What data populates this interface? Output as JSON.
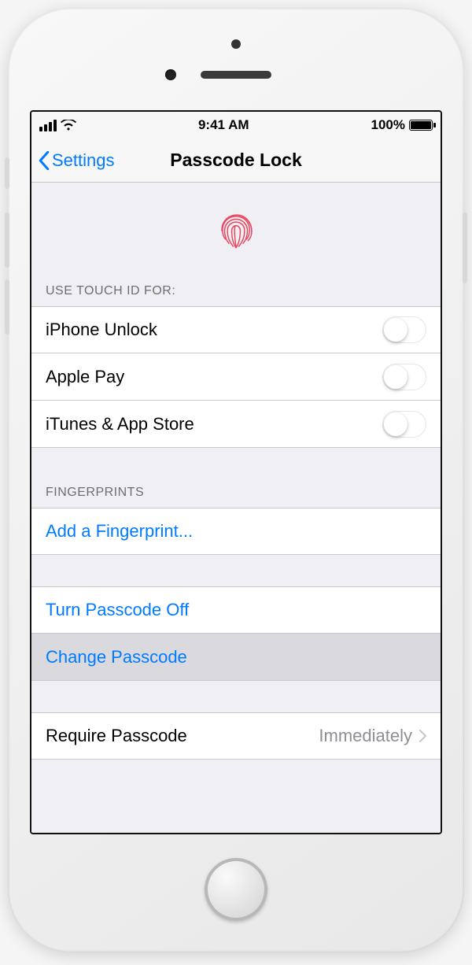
{
  "statusbar": {
    "time": "9:41 AM",
    "battery_pct": "100%"
  },
  "nav": {
    "back_label": "Settings",
    "title": "Passcode Lock"
  },
  "section_touchid": {
    "header": "USE TOUCH ID FOR:",
    "items": [
      {
        "label": "iPhone Unlock",
        "on": false
      },
      {
        "label": "Apple Pay",
        "on": false
      },
      {
        "label": "iTunes & App Store",
        "on": false
      }
    ]
  },
  "section_fingerprints": {
    "header": "FINGERPRINTS",
    "add_label": "Add a Fingerprint..."
  },
  "section_passcode": {
    "turn_off_label": "Turn Passcode Off",
    "change_label": "Change Passcode"
  },
  "section_require": {
    "label": "Require Passcode",
    "value": "Immediately"
  }
}
